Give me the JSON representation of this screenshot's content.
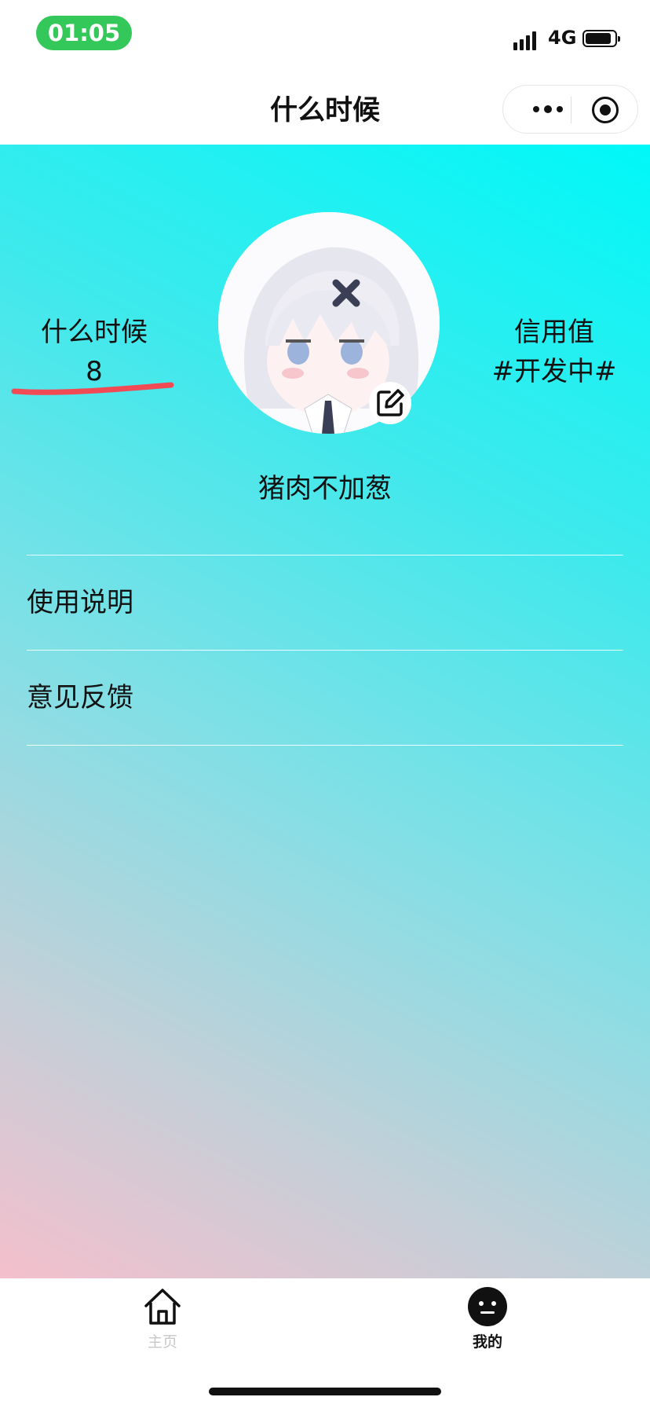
{
  "status_bar": {
    "time": "01:05",
    "network": "4G"
  },
  "nav": {
    "title": "什么时候"
  },
  "profile": {
    "left_stat": {
      "label": "什么时候",
      "value": "8"
    },
    "right_stat": {
      "label": "信用值",
      "value": "#开发中#"
    },
    "nickname": "猪肉不加葱"
  },
  "menu": [
    {
      "label": "使用说明"
    },
    {
      "label": "意见反馈"
    }
  ],
  "tab_bar": [
    {
      "label": "主页",
      "icon": "home-icon",
      "active": false
    },
    {
      "label": "我的",
      "icon": "face-icon",
      "active": true
    }
  ],
  "colors": {
    "gradient_top": "#00f8f8",
    "gradient_bottom": "#f4bfcc",
    "time_pill": "#34c759",
    "annotation_stroke": "#f04a55"
  }
}
